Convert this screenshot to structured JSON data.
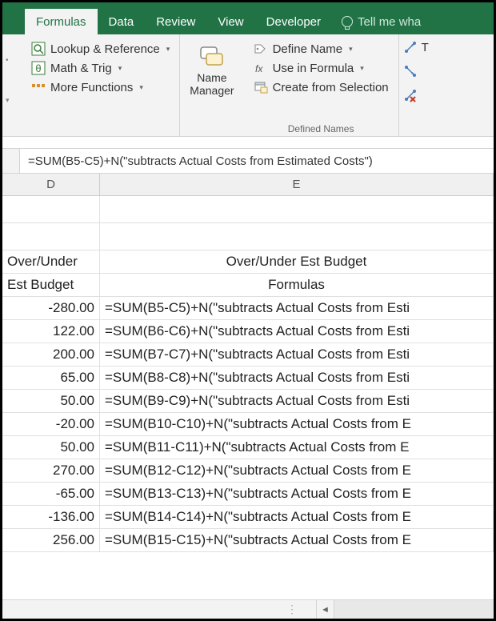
{
  "tabs": {
    "formulas": "Formulas",
    "data": "Data",
    "review": "Review",
    "view": "View",
    "developer": "Developer",
    "tellme": "Tell me wha"
  },
  "ribbon": {
    "lookup": "Lookup & Reference",
    "math": "Math & Trig",
    "more": "More Functions",
    "nameManager1": "Name",
    "nameManager2": "Manager",
    "defineName": "Define Name",
    "useInFormula": "Use in Formula",
    "createFromSel": "Create from Selection",
    "definedNamesCaption": "Defined Names",
    "traceT": "T"
  },
  "formula": "=SUM(B5-C5)+N(\"subtracts Actual Costs from Estimated Costs\")",
  "columns": {
    "d": "D",
    "e": "E"
  },
  "headers": {
    "d1": "Over/Under",
    "d2": "Est Budget",
    "e1": "Over/Under Est Budget",
    "e2": "Formulas"
  },
  "rows": [
    {
      "d": "-280.00",
      "e": "=SUM(B5-C5)+N(\"subtracts Actual Costs from Esti"
    },
    {
      "d": "122.00",
      "e": "=SUM(B6-C6)+N(\"subtracts Actual Costs from Esti"
    },
    {
      "d": "200.00",
      "e": "=SUM(B7-C7)+N(\"subtracts Actual Costs from Esti"
    },
    {
      "d": "65.00",
      "e": "=SUM(B8-C8)+N(\"subtracts Actual Costs from Esti"
    },
    {
      "d": "50.00",
      "e": "=SUM(B9-C9)+N(\"subtracts Actual Costs from Esti"
    },
    {
      "d": "-20.00",
      "e": "=SUM(B10-C10)+N(\"subtracts Actual Costs from E"
    },
    {
      "d": "50.00",
      "e": "=SUM(B11-C11)+N(\"subtracts Actual Costs from E"
    },
    {
      "d": "270.00",
      "e": "=SUM(B12-C12)+N(\"subtracts Actual Costs from E"
    },
    {
      "d": "-65.00",
      "e": "=SUM(B13-C13)+N(\"subtracts Actual Costs from E"
    },
    {
      "d": "-136.00",
      "e": "=SUM(B14-C14)+N(\"subtracts Actual Costs from E"
    },
    {
      "d": "256.00",
      "e": "=SUM(B15-C15)+N(\"subtracts Actual Costs from E"
    }
  ]
}
